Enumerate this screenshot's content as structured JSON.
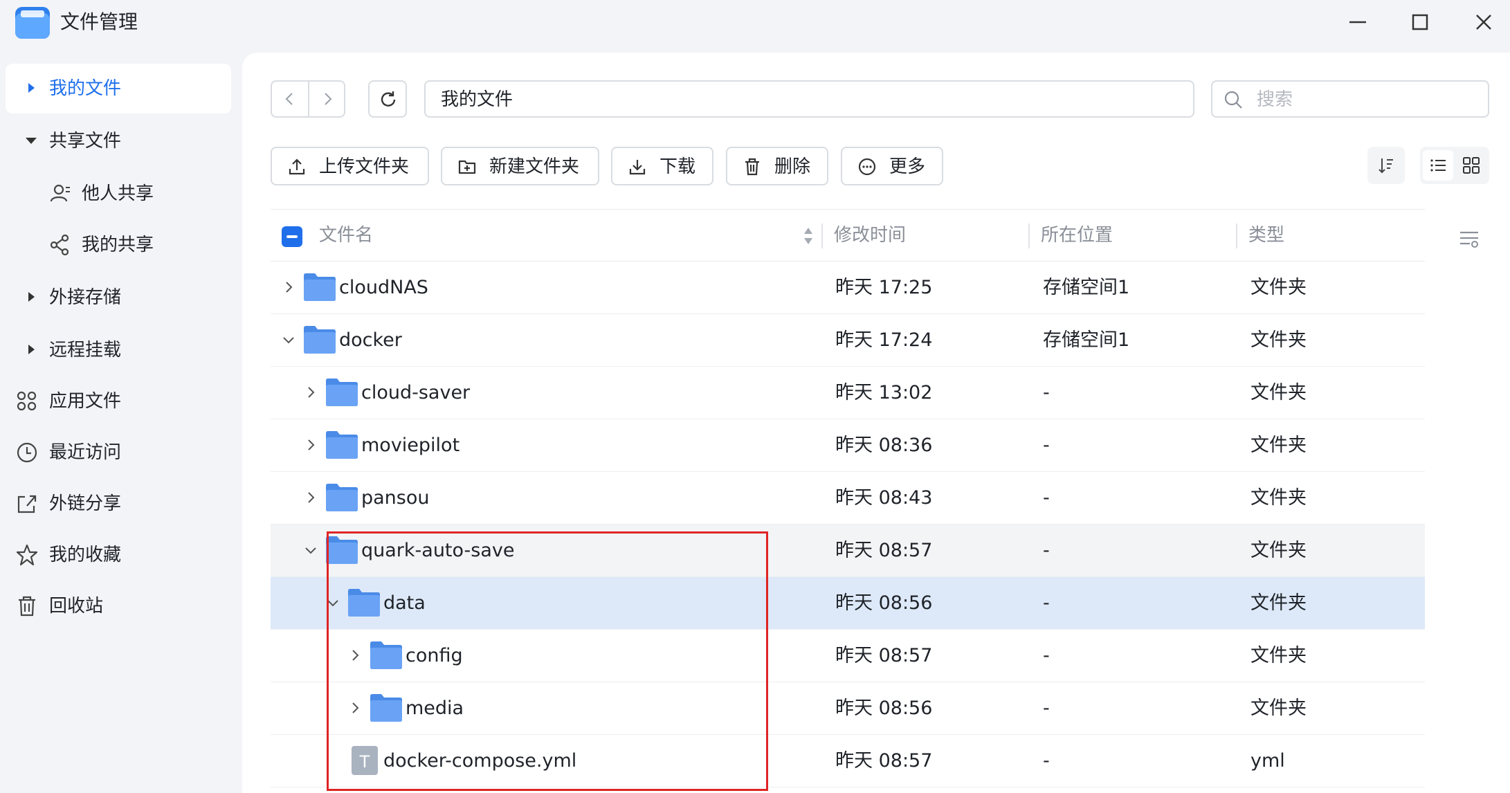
{
  "window": {
    "title": "文件管理"
  },
  "sidebar": {
    "items": [
      {
        "label": "我的文件",
        "icon": "caret-right-icon",
        "active": true
      },
      {
        "label": "共享文件",
        "icon": "caret-down-icon"
      },
      {
        "label": "他人共享",
        "icon": "user-icon"
      },
      {
        "label": "我的共享",
        "icon": "share-icon"
      },
      {
        "label": "外接存储",
        "icon": "caret-right-icon"
      },
      {
        "label": "远程挂载",
        "icon": "caret-right-icon"
      },
      {
        "label": "应用文件",
        "icon": "apps-icon"
      },
      {
        "label": "最近访问",
        "icon": "clock-icon"
      },
      {
        "label": "外链分享",
        "icon": "external-share-icon"
      },
      {
        "label": "我的收藏",
        "icon": "star-icon"
      },
      {
        "label": "回收站",
        "icon": "trash-icon"
      }
    ]
  },
  "path": {
    "value": "我的文件"
  },
  "search": {
    "placeholder": "搜索"
  },
  "toolbar": {
    "upload_label": "上传文件夹",
    "new_folder_label": "新建文件夹",
    "download_label": "下载",
    "delete_label": "删除",
    "more_label": "更多"
  },
  "table": {
    "columns": {
      "name": "文件名",
      "time": "修改时间",
      "location": "所在位置",
      "type": "类型"
    },
    "rows": [
      {
        "name": "cloudNAS",
        "time": "昨天 17:25",
        "location": "存储空间1",
        "type": "文件夹",
        "depth": 0,
        "expanded": false,
        "kind": "folder"
      },
      {
        "name": "docker",
        "time": "昨天 17:24",
        "location": "存储空间1",
        "type": "文件夹",
        "depth": 0,
        "expanded": true,
        "kind": "folder"
      },
      {
        "name": "cloud-saver",
        "time": "昨天 13:02",
        "location": "-",
        "type": "文件夹",
        "depth": 1,
        "expanded": false,
        "kind": "folder"
      },
      {
        "name": "moviepilot",
        "time": "昨天 08:36",
        "location": "-",
        "type": "文件夹",
        "depth": 1,
        "expanded": false,
        "kind": "folder"
      },
      {
        "name": "pansou",
        "time": "昨天 08:43",
        "location": "-",
        "type": "文件夹",
        "depth": 1,
        "expanded": false,
        "kind": "folder"
      },
      {
        "name": "quark-auto-save",
        "time": "昨天 08:57",
        "location": "-",
        "type": "文件夹",
        "depth": 1,
        "expanded": true,
        "kind": "folder",
        "state": "hover"
      },
      {
        "name": "data",
        "time": "昨天 08:56",
        "location": "-",
        "type": "文件夹",
        "depth": 2,
        "expanded": true,
        "kind": "folder",
        "state": "selected"
      },
      {
        "name": "config",
        "time": "昨天 08:57",
        "location": "-",
        "type": "文件夹",
        "depth": 3,
        "expanded": false,
        "kind": "folder"
      },
      {
        "name": "media",
        "time": "昨天 08:56",
        "location": "-",
        "type": "文件夹",
        "depth": 3,
        "expanded": false,
        "kind": "folder"
      },
      {
        "name": "docker-compose.yml",
        "time": "昨天 08:57",
        "location": "-",
        "type": "yml",
        "depth": 2,
        "expanded": null,
        "kind": "file",
        "icon_letter": "T"
      }
    ]
  },
  "colors": {
    "accent": "#1f6feb",
    "folder": "#6aa3f5",
    "selected_row": "#dde9f8",
    "highlight_box": "#e02424"
  }
}
